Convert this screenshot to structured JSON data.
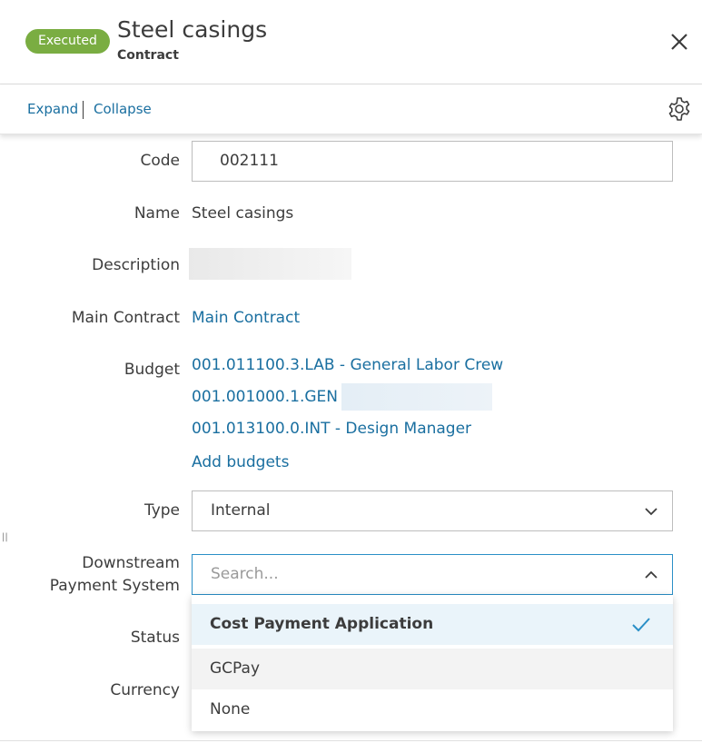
{
  "header": {
    "status_badge": "Executed",
    "title": "Steel casings",
    "subtitle": "Contract"
  },
  "toolbar": {
    "expand_label": "Expand",
    "collapse_label": "Collapse"
  },
  "form": {
    "code": {
      "label": "Code",
      "value": "002111"
    },
    "name": {
      "label": "Name",
      "value": "Steel casings"
    },
    "description": {
      "label": "Description"
    },
    "main_contract": {
      "label": "Main Contract",
      "link": "Main Contract"
    },
    "budget": {
      "label": "Budget",
      "items": [
        "001.011100.3.LAB - General Labor Crew",
        "001.001000.1.GEN -",
        "001.013100.0.INT - Design Manager"
      ],
      "add_label": "Add budgets"
    },
    "type": {
      "label": "Type",
      "value": "Internal"
    },
    "downstream": {
      "label_line1": "Downstream",
      "label_line2": "Payment System",
      "placeholder": "Search...",
      "options": [
        {
          "label": "Cost Payment Application",
          "selected": true
        },
        {
          "label": "GCPay",
          "selected": false
        },
        {
          "label": "None",
          "selected": false
        }
      ]
    },
    "status": {
      "label": "Status"
    },
    "currency": {
      "label": "Currency"
    }
  },
  "colors": {
    "badge": "#7aad42",
    "link": "#1a6fa0",
    "focus_border": "#2a8fc7",
    "selected_option_bg": "#eaf4fa"
  },
  "icons": {
    "close": "close-icon",
    "settings": "gear-icon",
    "dropdown_closed": "chevron-down-icon",
    "dropdown_open": "chevron-up-icon",
    "selected": "checkmark-icon"
  }
}
